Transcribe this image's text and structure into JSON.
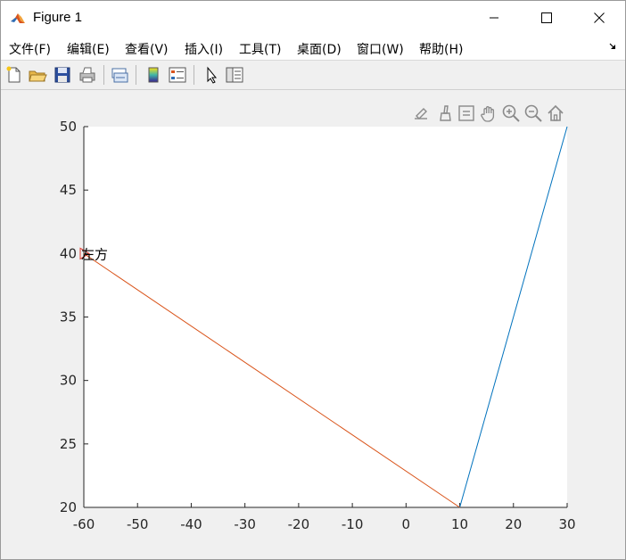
{
  "window": {
    "title": "Figure 1"
  },
  "menu": [
    {
      "label": "文件(F)",
      "key": "file"
    },
    {
      "label": "编辑(E)",
      "key": "edit"
    },
    {
      "label": "查看(V)",
      "key": "view"
    },
    {
      "label": "插入(I)",
      "key": "insert"
    },
    {
      "label": "工具(T)",
      "key": "tools"
    },
    {
      "label": "桌面(D)",
      "key": "desktop"
    },
    {
      "label": "窗口(W)",
      "key": "window"
    },
    {
      "label": "帮助(H)",
      "key": "help"
    }
  ],
  "toolbar_icons": [
    "new-figure-icon",
    "open-file-icon",
    "save-icon",
    "print-icon",
    "link-plot-icon",
    "insert-colorbar-icon",
    "insert-legend-icon",
    "edit-plot-pointer-icon",
    "property-inspector-icon"
  ],
  "axes_toolbar_icons": [
    "export-icon",
    "brush-icon",
    "data-tips-icon",
    "pan-icon",
    "zoom-in-icon",
    "zoom-out-icon",
    "home-icon"
  ],
  "chart_data": {
    "type": "line",
    "title": "",
    "xlabel": "",
    "ylabel": "",
    "xlim": [
      -60,
      30
    ],
    "ylim": [
      20,
      50
    ],
    "xticks": [
      -60,
      -50,
      -40,
      -30,
      -20,
      -10,
      0,
      10,
      20,
      30
    ],
    "yticks": [
      20,
      25,
      30,
      35,
      40,
      45,
      50
    ],
    "grid": false,
    "series": [
      {
        "color": "#0072bd",
        "points": [
          [
            10,
            20
          ],
          [
            30,
            50
          ]
        ]
      },
      {
        "color": "#d95319",
        "points": [
          [
            10,
            20
          ],
          [
            -60,
            40
          ]
        ]
      }
    ],
    "annotations": [
      {
        "text": "左方",
        "x": -60,
        "y": 40,
        "marker": "triangle-right",
        "marker_color": "#e03c31"
      }
    ]
  }
}
